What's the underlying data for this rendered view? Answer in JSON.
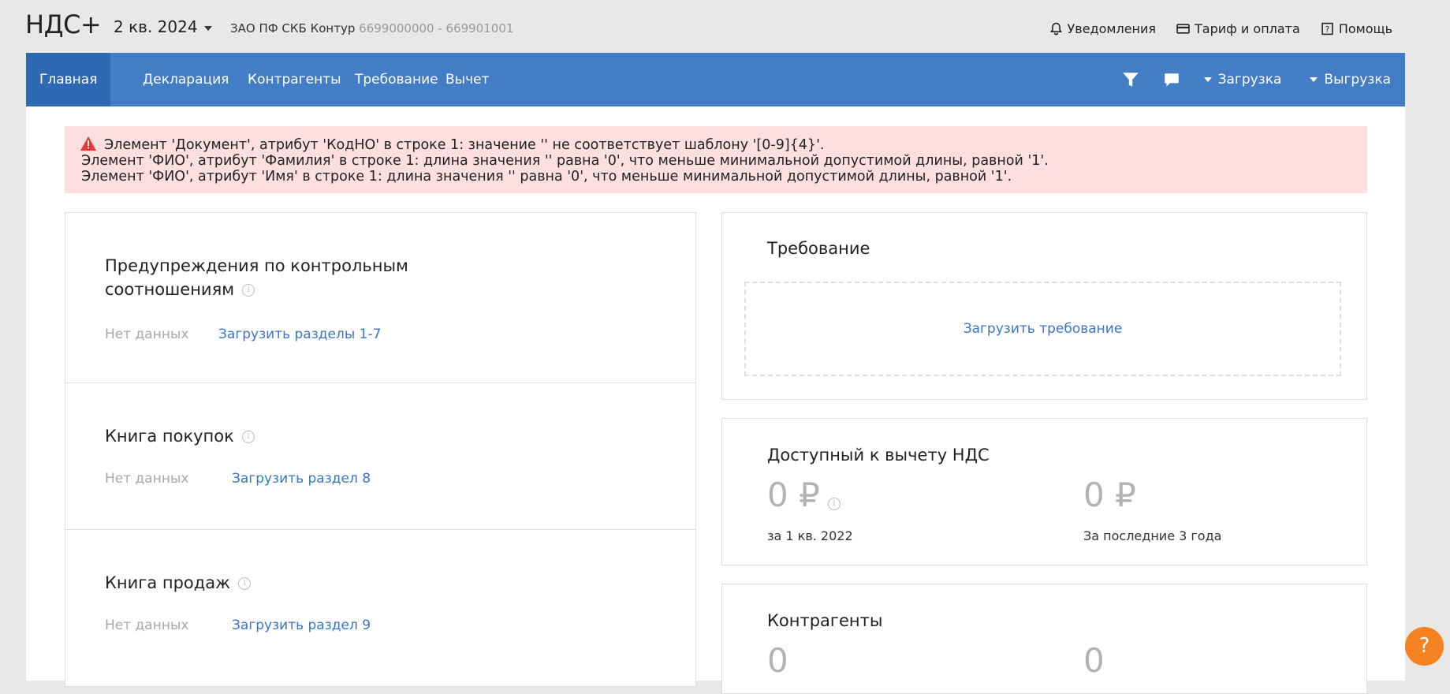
{
  "header": {
    "logo": "НДС+",
    "period": "2 кв. 2024",
    "org_name": "ЗАО ПФ СКБ Контур",
    "org_inn_kpp": "6699000000 - 669901001",
    "links": [
      {
        "label": "Уведомления",
        "icon": "bell-icon"
      },
      {
        "label": "Тариф и оплата",
        "icon": "credit-card-icon"
      },
      {
        "label": "Помощь",
        "icon": "help-square-icon"
      }
    ]
  },
  "nav": {
    "tabs": [
      {
        "label": "Главная",
        "active": true
      },
      {
        "label": "Декларация"
      },
      {
        "label": "Контрагенты"
      },
      {
        "label": "Требование"
      },
      {
        "label": "Вычет"
      }
    ],
    "upload_label": "Загрузка",
    "download_label": "Выгрузка",
    "icons": [
      "filter-icon",
      "chat-icon"
    ]
  },
  "alert": {
    "lines": [
      "Элемент 'Документ', атрибут 'КодНО' в строке 1: значение '' не соответствует шаблону '[0-9]{4}'.",
      "Элемент 'ФИО', атрибут 'Фамилия' в строке 1: длина значения '' равна '0', что меньше минимальной допустимой длины, равной '1'.",
      "Элемент 'ФИО', атрибут 'Имя' в строке 1: длина значения '' равна '0', что меньше минимальной допустимой длины, равной '1'."
    ],
    "color": "#fddfdf"
  },
  "left_cards": {
    "control_ratios": {
      "title_line1": "Предупреждения по контрольным",
      "title_line2": "соотношениям",
      "status": "Нет данных",
      "link": "Загрузить разделы 1-7"
    },
    "purchase_book": {
      "title": "Книга покупок",
      "status": "Нет данных",
      "link": "Загрузить раздел 8"
    },
    "sales_book": {
      "title": "Книга продаж",
      "status": "Нет данных",
      "link": "Загрузить раздел 9"
    }
  },
  "right_cards": {
    "requirement": {
      "title": "Требование",
      "upload_link": "Загрузить требование"
    },
    "vat_deduction": {
      "title": "Доступный к вычету НДС",
      "amount1": "0 ₽",
      "period1": "за 1 кв. 2022",
      "amount2": "0 ₽",
      "period2": "За последние 3 года"
    },
    "counterparties": {
      "title": "Контрагенты",
      "value1": "0",
      "value2": "0"
    }
  },
  "help_button": "?",
  "colors": {
    "nav": "#427dc6",
    "nav_active": "#2f69b3",
    "link": "#3a76c2",
    "help": "#f58220"
  }
}
